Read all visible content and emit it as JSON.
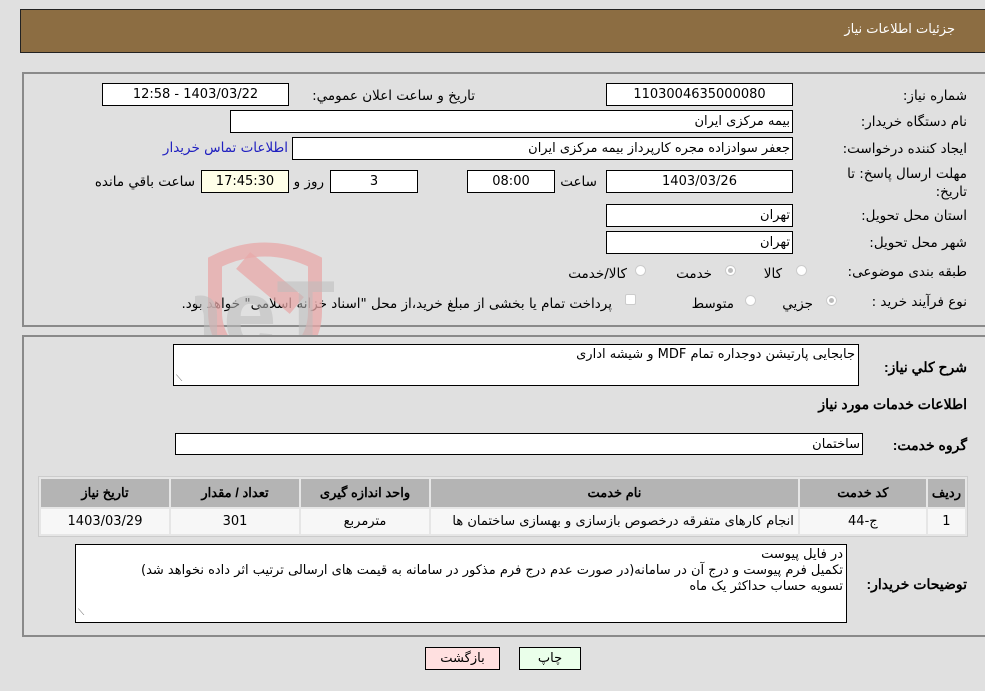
{
  "header": {
    "title": "جزئیات اطلاعات نیاز"
  },
  "info": {
    "need_number_label": "شماره نیاز:",
    "need_number": "1103004635000080",
    "announce_label": "تاریخ و ساعت اعلان عمومي:",
    "announce_value": "1403/03/22 - 12:58",
    "buyer_org_label": "نام دستگاه خریدار:",
    "buyer_org": "بیمه مرکزی ایران",
    "creator_label": "ایجاد کننده درخواست:",
    "creator": "جعفر سوادزاده مجره کارپرداز بیمه مرکزی ایران",
    "contact_link": "اطلاعات تماس خریدار",
    "deadline_label_1": "مهلت ارسال پاسخ: تا",
    "deadline_label_2": "تاریخ:",
    "deadline_date": "1403/03/26",
    "time_label": "ساعت",
    "deadline_time": "08:00",
    "days": "3",
    "days_label": "روز و",
    "remaining": "17:45:30",
    "remaining_label": "ساعت باقي مانده",
    "province_label": "استان محل تحویل:",
    "province": "تهران",
    "city_label": "شهر محل تحویل:",
    "city": "تهران",
    "category_label": "طبقه بندی موضوعی:",
    "category_options": [
      {
        "label": "کالا",
        "checked": false
      },
      {
        "label": "خدمت",
        "checked": true
      },
      {
        "label": "کالا/خدمت",
        "checked": false
      }
    ],
    "process_label": "نوع فرآیند خرید :",
    "process_options": [
      {
        "label": "جزیي",
        "checked": true
      },
      {
        "label": "متوسط",
        "checked": false
      }
    ],
    "treasury_note": "پرداخت تمام یا بخشی از مبلغ خرید،از محل \"اسناد خزانه اسلامی\" خواهد بود.",
    "treasury_checked": false
  },
  "details": {
    "summary_label": "شرح کلي نیاز:",
    "summary": "جابجایی پارتیشن دوجداره تمام MDF و شیشه اداری",
    "services_heading": "اطلاعات خدمات مورد نیاز",
    "service_group_label": "گروه خدمت:",
    "service_group": "ساختمان",
    "table": {
      "headers": [
        "ردیف",
        "کد خدمت",
        "نام خدمت",
        "واحد اندازه گیری",
        "تعداد / مقدار",
        "تاریخ نیاز"
      ],
      "rows": [
        [
          "1",
          "ج-44",
          "انجام کارهای متفرقه درخصوص بازسازی و بهسازی ساختمان ها",
          "مترمربع",
          "301",
          "1403/03/29"
        ]
      ]
    },
    "buyer_notes_label": "توضیحات خریدار:",
    "buyer_notes": [
      "در فایل پیوست",
      "تکمیل فرم پیوست و درج آن در سامانه(در صورت عدم درج فرم مذکور در سامانه به قیمت های ارسالی ترتیب اثر داده نخواهد شد)",
      "تسویه حساب حداکثر یک ماه"
    ]
  },
  "buttons": {
    "print": "چاپ",
    "back": "بازگشت"
  },
  "colors": {
    "header_bg": "#8c6d42",
    "print_bg": "#eaffea",
    "back_bg": "#ffe0e0",
    "link": "#2020c0"
  },
  "watermark": {
    "text": "AriaTender.neT"
  }
}
